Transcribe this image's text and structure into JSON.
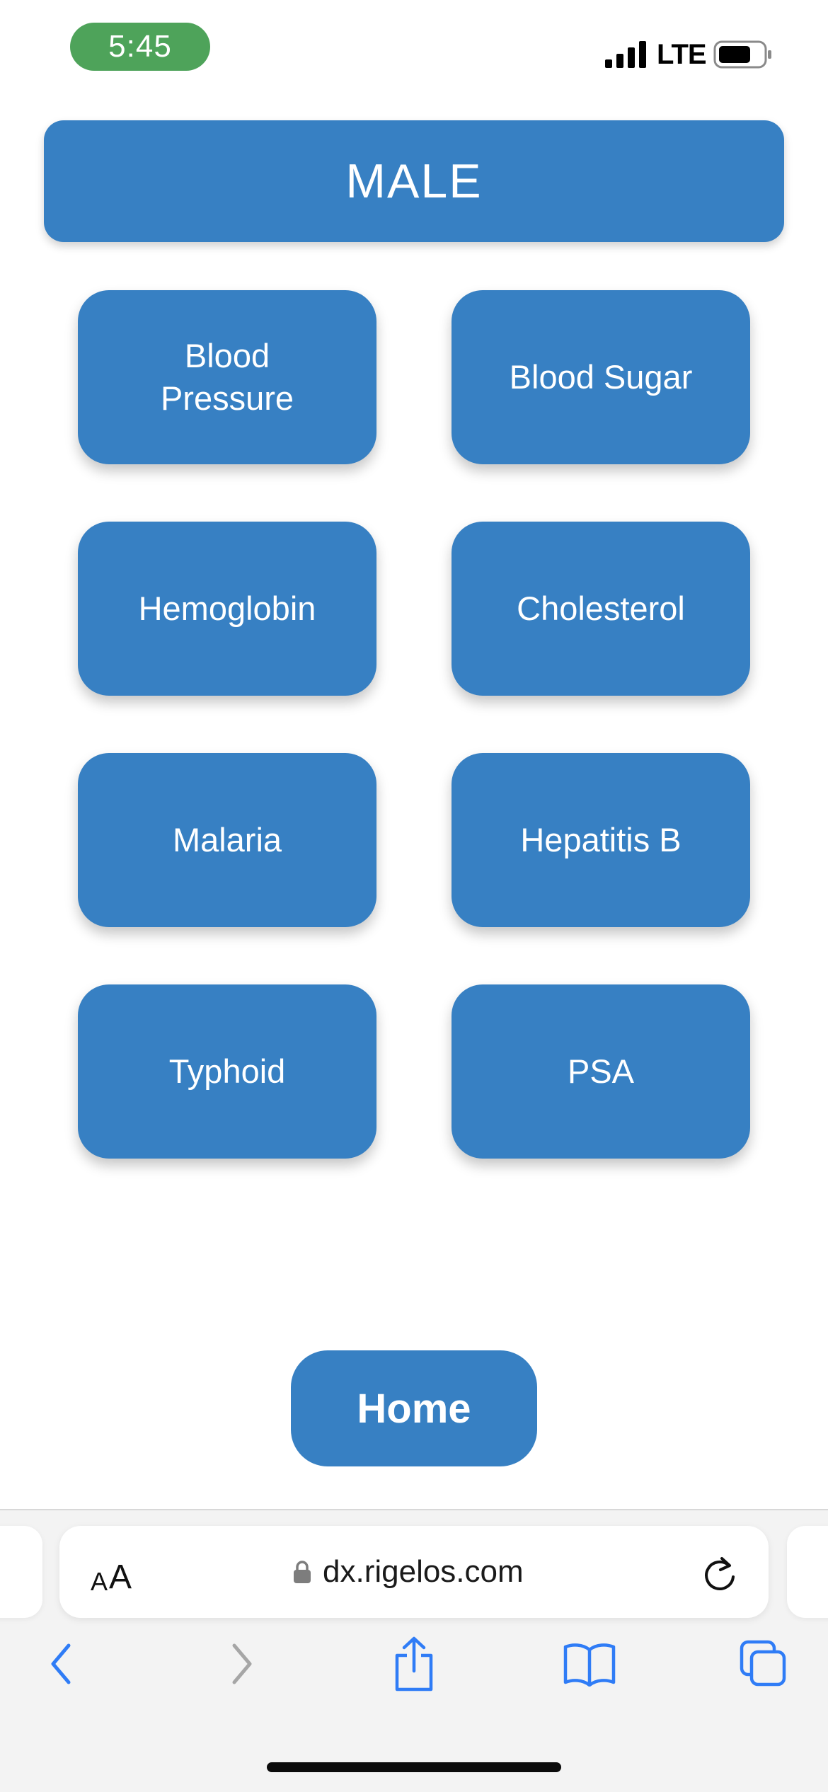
{
  "status_bar": {
    "time": "5:45",
    "network": "LTE",
    "icons": [
      "signal-icon",
      "battery-icon"
    ],
    "time_pill_color": "#4ea35a"
  },
  "header": {
    "title": "MALE"
  },
  "tests": [
    {
      "label": "Blood Pressure"
    },
    {
      "label": "Blood Sugar"
    },
    {
      "label": "Hemoglobin"
    },
    {
      "label": "Cholesterol"
    },
    {
      "label": "Malaria"
    },
    {
      "label": "Hepatitis B"
    },
    {
      "label": "Typhoid"
    },
    {
      "label": "PSA"
    }
  ],
  "home_button": {
    "label": "Home"
  },
  "browser": {
    "text_size_small": "A",
    "text_size_large": "A",
    "url": "dx.rigelos.com",
    "icons": [
      "lock-icon",
      "reload-icon",
      "back-icon",
      "forward-icon",
      "share-icon",
      "bookmarks-icon",
      "tabs-icon"
    ]
  },
  "colors": {
    "accent": "#3780c3",
    "browser_blue": "#2f7cf6",
    "disabled_gray": "#a6a6a6"
  }
}
